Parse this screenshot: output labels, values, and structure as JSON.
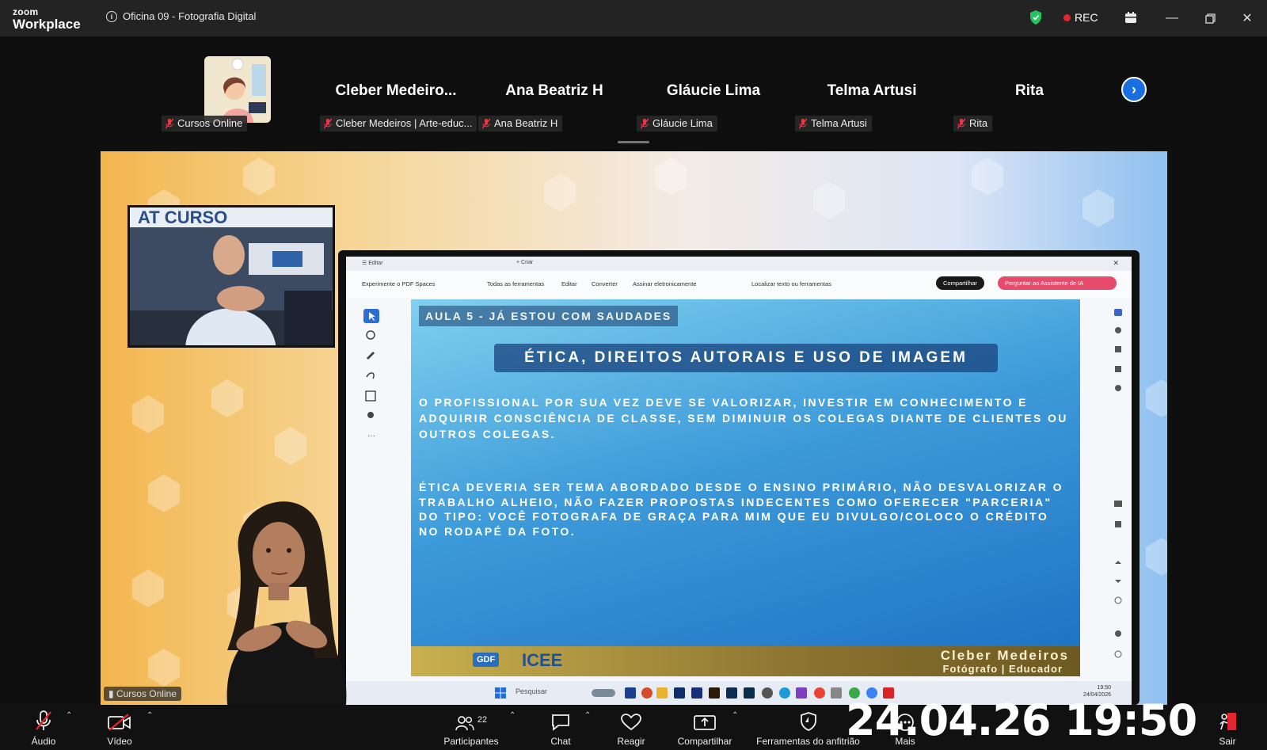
{
  "app": {
    "brand_small": "zoom",
    "brand_large": "Workplace",
    "meeting_title": "Oficina 09 - Fotografia Digital",
    "rec_label": "REC"
  },
  "participants": [
    {
      "tile_name": "",
      "tag": "Cursos Online"
    },
    {
      "tile_name": "Cleber  Medeiro...",
      "tag": "Cleber Medeiros | Arte-educ..."
    },
    {
      "tile_name": "Ana Beatriz H",
      "tag": "Ana Beatriz H"
    },
    {
      "tile_name": "Gláucie Lima",
      "tag": "Gláucie Lima"
    },
    {
      "tile_name": "Telma Artusi",
      "tag": "Telma Artusi"
    },
    {
      "tile_name": "Rita",
      "tag": "Rita"
    }
  ],
  "share": {
    "presenter_label": "Cursos Online",
    "slide": {
      "aula": "AULA 5 - JÁ ESTOU COM SAUDADES",
      "title": "ÉTICA, DIREITOS AUTORAIS E USO DE IMAGEM",
      "p1": "O PROFISSIONAL POR SUA VEZ DEVE SE VALORIZAR, INVESTIR EM CONHECIMENTO E ADQUIRIR CONSCIÊNCIA DE CLASSE, SEM DIMINUIR OS COLEGAS DIANTE DE CLIENTES OU OUTROS COLEGAS.",
      "p2": "ÉTICA DEVERIA SER TEMA ABORDADO DESDE O ENSINO PRIMÁRIO, NÃO DESVALORIZAR O TRABALHO ALHEIO, NÃO FAZER PROPOSTAS INDECENTES COMO OFERECER \"PARCERIA\" DO TIPO: VOCÊ FOTOGRAFA DE GRAÇA PARA MIM QUE EU DIVULGO/COLOCO O CRÉDITO NO RODAPÉ DA FOTO.",
      "author": "Cleber Medeiros",
      "role": "Fotógrafo | Educador",
      "logo_gdf": "GDF",
      "logo_icee": "ICEE"
    },
    "pdf_toolbar": {
      "tab": "Editar",
      "new_tab": "+ Criar",
      "promo": "Experimente o PDF Spaces",
      "menu": [
        "Todas as ferramentas",
        "Editar",
        "Converter",
        "Assinar eletronicamente"
      ],
      "search": "Localizar texto ou ferramentas",
      "share_btn": "Compartilhar",
      "ai_btn": "Perguntar ao Assistente de IA"
    },
    "taskbar": {
      "search": "Pesquisar",
      "time": "19:50",
      "date": "24/04/2026"
    }
  },
  "toolbar": {
    "audio": "Áudio",
    "video": "Vídeo",
    "participants": "Participantes",
    "participants_count": "22",
    "chat": "Chat",
    "react": "Reagir",
    "share": "Compartilhar",
    "host_tools": "Ferramentas do anfitrião",
    "more": "Mais",
    "leave": "Sair"
  },
  "overlay_timestamp": "24.04.26 19:50",
  "colors": {
    "titlebar": "#232323",
    "rec_dot": "#e3262e",
    "next_button": "#1a6fe0",
    "ai_button": "#e64b6b"
  }
}
